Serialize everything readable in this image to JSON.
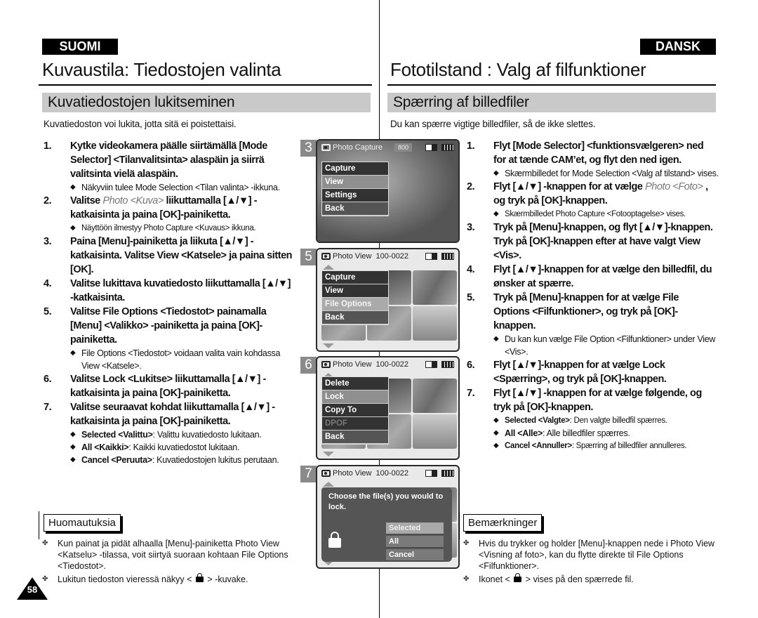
{
  "badges": {
    "left": "SUOMI",
    "right": "DANSK"
  },
  "left": {
    "title": "Kuvaustila: Tiedostojen valinta",
    "section": "Kuvatiedostojen lukitseminen",
    "intro": "Kuvatiedoston voi lukita, jotta sitä ei poistettaisi.",
    "steps": [
      {
        "num": "1.",
        "parts": [
          "Kytke videokamera päälle siirtämällä [Mode Selector] <Tilanvalitsinta> alaspäin ja siirrä valitsinta vielä alaspäin."
        ],
        "notes": [
          {
            "label": "",
            "text": "Näkyviin tulee Mode Selection <Tilan valinta> -ikkuna."
          }
        ]
      },
      {
        "num": "2.",
        "parts": [
          "Valitse ",
          "Photo <Kuva>",
          " liikuttamalla [▲/▼] -katkaisinta ja paina [OK]-painiketta."
        ],
        "notes": [
          {
            "label": "",
            "text": "Näyttöön ilmestyy Photo Capture <Kuvaus> ikkuna.",
            "small": true
          }
        ]
      },
      {
        "num": "3.",
        "parts": [
          "Paina [Menu]-painiketta ja liikuta [▲/▼] -katkaisinta. Valitse View <Katsele> ja paina sitten [OK]."
        ],
        "notes": []
      },
      {
        "num": "4.",
        "parts": [
          "Valitse lukittava kuvatiedosto liikuttamalla [▲/▼] -katkaisinta."
        ],
        "notes": []
      },
      {
        "num": "5.",
        "parts": [
          "Valitse File Options <Tiedostot> painamalla [Menu] <Valikko> -painiketta ja paina [OK]-painiketta."
        ],
        "notes": [
          {
            "label": "",
            "text": "File Options <Tiedostot> voidaan valita vain kohdassa View <Katsele>."
          }
        ]
      },
      {
        "num": "6.",
        "parts": [
          "Valitse Lock <Lukitse> liikuttamalla [▲/▼] -katkaisinta ja paina [OK]-painiketta."
        ],
        "notes": []
      },
      {
        "num": "7.",
        "parts": [
          "Valitse seuraavat kohdat liikuttamalla [▲/▼] -katkaisinta ja paina [OK]-painiketta."
        ],
        "notes": [
          {
            "label": "Selected <Valittu>",
            "text": ": Valittu kuvatiedosto lukitaan."
          },
          {
            "label": "All <Kaikki>",
            "text": ": Kaikki kuvatiedostot lukitaan."
          },
          {
            "label": "Cancel <Peruuta>",
            "text": ": Kuvatiedostojen lukitus perutaan."
          }
        ]
      }
    ],
    "notes_title": "Huomautuksia",
    "notes": [
      {
        "text": "Kun painat ja pidät alhaalla [Menu]-painiketta Photo View <Katselu> -tilassa, voit siirtyä suoraan kohtaan File Options <Tiedostot>."
      },
      {
        "pre": "Lukitun tiedoston vieressä näkyy <",
        "post": "> -kuvake."
      }
    ]
  },
  "right": {
    "title": "Fototilstand  : Valg af filfunktioner",
    "section": "Spærring af billedfiler",
    "intro": "Du kan spærre vigtige billedfiler, så de ikke slettes.",
    "steps": [
      {
        "num": "1.",
        "parts": [
          "Flyt [Mode Selector] <funktionsvælgeren> ned for at tænde CAM’et, og flyt den ned igen."
        ],
        "notes": [
          {
            "label": "",
            "text": "Skærmbilledet for Mode Selection <Valg af tilstand> vises."
          }
        ]
      },
      {
        "num": "2.",
        "parts": [
          "Flyt [▲/▼]  -knappen for at vælge ",
          "Photo <Foto>",
          " , og tryk på [OK]-knappen."
        ],
        "notes": [
          {
            "label": "",
            "text": "Skærmbilledet Photo Capture <Fotooptagelse> vises.",
            "small": true
          }
        ]
      },
      {
        "num": "3.",
        "parts": [
          "Tryk på [Menu]-knappen, og flyt [▲/▼]-knappen. Tryk på [OK]-knappen efter at have valgt View <Vis>."
        ],
        "notes": []
      },
      {
        "num": "4.",
        "parts": [
          "Flyt [▲/▼]-knappen for at vælge den billedfil, du ønsker at spærre."
        ],
        "notes": []
      },
      {
        "num": "5.",
        "parts": [
          "Tryk på [Menu]-knappen for at vælge File Options <Filfunktioner>, og tryk på [OK]-knappen."
        ],
        "notes": [
          {
            "label": "",
            "text": "Du kan kun vælge File Option <Filfunktioner> under View <Vis>."
          }
        ]
      },
      {
        "num": "6.",
        "parts": [
          "Flyt [▲/▼]-knappen for at vælge Lock <Spærring>, og tryk på [OK]-knappen."
        ],
        "notes": []
      },
      {
        "num": "7.",
        "parts": [
          "Flyt [▲/▼]  -knappen for at vælge følgende, og tryk på [OK]-knappen."
        ],
        "notes": [
          {
            "label": "Selected <Valgte>",
            "text": ": Den valgte billedfil spærres.",
            "small": true
          },
          {
            "label": "All <Alle>",
            "text": ": Alle billedfiler spærres."
          },
          {
            "label": "Cancel <Annuller>",
            "text": ": Spærring af billedfiler annulleres.",
            "small": true
          }
        ]
      }
    ],
    "notes_title": "Bemærkninger",
    "notes": [
      {
        "text": "Hvis du trykker og holder [Menu]-knappen nede i Photo View <Visning af foto>, kan du flytte direkte til File Options <Filfunktioner>."
      },
      {
        "pre": "Ikonet <",
        "post": "> vises på den spærrede fil."
      }
    ]
  },
  "screens": [
    {
      "step": "3",
      "header": "Photo Capture",
      "count": "800",
      "menu": [
        "Capture",
        "View",
        "Settings",
        "Back"
      ]
    },
    {
      "step": "5",
      "header": "Photo View  100-0022",
      "menu": [
        "Capture",
        "View",
        "File Options",
        "Back"
      ]
    },
    {
      "step": "6",
      "header": "Photo View  100-0022",
      "menu": [
        "Delete",
        "Lock",
        "Copy To",
        "DPOF",
        "Back"
      ]
    },
    {
      "step": "7",
      "header": "Photo View  100-0022",
      "dialog": "Choose the file(s) you would to lock.",
      "buttons": [
        "Selected",
        "All",
        "Cancel"
      ]
    }
  ],
  "page_number": "58"
}
